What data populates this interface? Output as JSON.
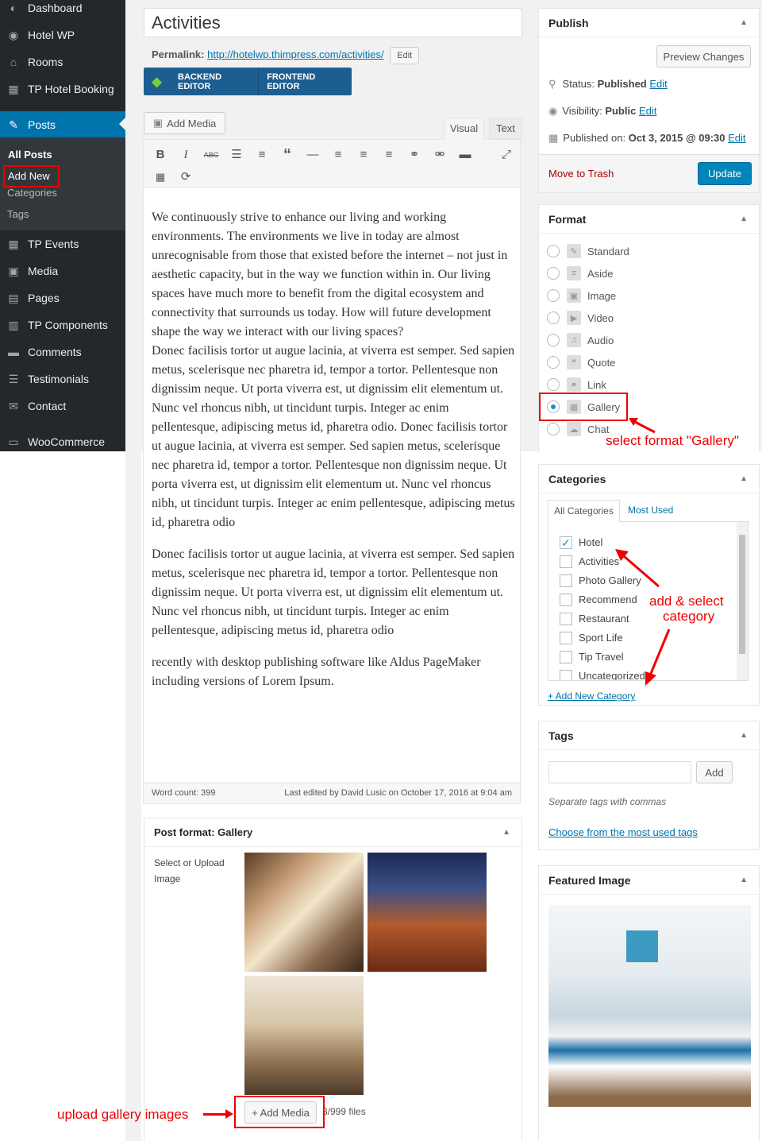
{
  "sidebar": {
    "items": [
      {
        "label": "Dashboard",
        "icon": "dashboard-icon",
        "glyph": "◐"
      },
      {
        "label": "Hotel WP",
        "icon": "hotel-wp-icon",
        "glyph": "◉"
      },
      {
        "label": "Rooms",
        "icon": "home-icon",
        "glyph": "⌂"
      },
      {
        "label": "TP Hotel Booking",
        "icon": "calendar-icon",
        "glyph": "▦"
      },
      {
        "label": "Posts",
        "icon": "pin-icon",
        "glyph": "✎"
      },
      {
        "label": "TP Events",
        "icon": "calendar-icon",
        "glyph": "▦"
      },
      {
        "label": "Media",
        "icon": "media-icon",
        "glyph": "▣"
      },
      {
        "label": "Pages",
        "icon": "pages-icon",
        "glyph": "▤"
      },
      {
        "label": "TP Components",
        "icon": "components-icon",
        "glyph": "▥"
      },
      {
        "label": "Comments",
        "icon": "comments-icon",
        "glyph": "▬"
      },
      {
        "label": "Testimonials",
        "icon": "testimonials-icon",
        "glyph": "☰"
      },
      {
        "label": "Contact",
        "icon": "mail-icon",
        "glyph": "✉"
      },
      {
        "label": "WooCommerce",
        "icon": "woocommerce-icon",
        "glyph": "▭"
      }
    ],
    "sub": [
      "All Posts",
      "Add New",
      "Categories",
      "Tags"
    ]
  },
  "post": {
    "title": "Activities",
    "permalink_label": "Permalink:",
    "permalink_url": "http://hotelwp.thimpress.com/activities/",
    "edit": "Edit",
    "backend": "BACKEND EDITOR",
    "frontend": "FRONTEND EDITOR",
    "add_media": "Add Media",
    "tab_visual": "Visual",
    "tab_text": "Text",
    "p1": "We continuously strive to enhance our living and working environments. The environments we live in today are almost unrecognisable from those that existed before the internet – not just in aesthetic capacity, but in the way we function within in. Our living spaces have much more to benefit from the digital ecosystem and connectivity that surrounds us today. How will future development shape the way we interact with our living spaces?",
    "p2": "Donec facilisis tortor ut augue lacinia, at viverra est semper. Sed sapien metus, scelerisque nec pharetra id, tempor a tortor. Pellentesque non dignissim neque. Ut porta viverra est, ut dignissim elit elementum ut. Nunc vel rhoncus nibh, ut tincidunt turpis. Integer ac enim pellentesque, adipiscing metus id, pharetra odio. Donec facilisis tortor ut augue lacinia, at viverra est semper. Sed sapien metus, scelerisque nec pharetra id, tempor a tortor. Pellentesque non dignissim neque. Ut porta viverra est, ut dignissim elit elementum ut. Nunc vel rhoncus nibh, ut tincidunt turpis. Integer ac enim pellentesque, adipiscing metus id, pharetra odio",
    "p3": "Donec facilisis tortor ut augue lacinia, at viverra est semper. Sed sapien metus, scelerisque nec pharetra id, tempor a tortor. Pellentesque non dignissim neque. Ut porta viverra est, ut dignissim elit elementum ut. Nunc vel rhoncus nibh, ut tincidunt turpis. Integer ac enim pellentesque, adipiscing metus id, pharetra odio",
    "p4": "recently with desktop publishing software like Aldus PageMaker including versions of Lorem Ipsum.",
    "word_count": "Word count: 399",
    "last_edited": "Last edited by David Lusic on October 17, 2016 at 9:04 am"
  },
  "gallery_box": {
    "title": "Post format: Gallery",
    "label": "Select or Upload Image",
    "add_media": "+ Add Media",
    "files": "3/999 files",
    "annotation": "upload gallery images"
  },
  "publish": {
    "title": "Publish",
    "preview": "Preview Changes",
    "status_label": "Status:",
    "status": "Published",
    "visibility_label": "Visibility:",
    "visibility": "Public",
    "published_label": "Published on:",
    "published": "Oct 3, 2015 @ 09:30",
    "edit": "Edit",
    "trash": "Move to Trash",
    "update": "Update"
  },
  "format": {
    "title": "Format",
    "options": [
      "Standard",
      "Aside",
      "Image",
      "Video",
      "Audio",
      "Quote",
      "Link",
      "Gallery",
      "Chat"
    ],
    "glyphs": [
      "✎",
      "≡",
      "▣",
      "▶",
      "♫",
      "❝",
      "⚭",
      "▦",
      "☁"
    ],
    "annotation": "select format \"Gallery\""
  },
  "categories": {
    "title": "Categories",
    "tab_all": "All Categories",
    "tab_used": "Most Used",
    "items": [
      "Hotel",
      "Activities",
      "Photo Gallery",
      "Recommend",
      "Restaurant",
      "Sport Life",
      "Tip Travel",
      "Uncategorized"
    ],
    "add_new": "+ Add New Category",
    "annotation1": "add & select",
    "annotation2": "category"
  },
  "tags": {
    "title": "Tags",
    "add": "Add",
    "hint": "Separate tags with commas",
    "choose": "Choose from the most used tags"
  },
  "featured": {
    "title": "Featured Image"
  },
  "colors": {
    "accent": "#0073aa",
    "sidebar": "#23282d",
    "annotation": "#e00000"
  }
}
